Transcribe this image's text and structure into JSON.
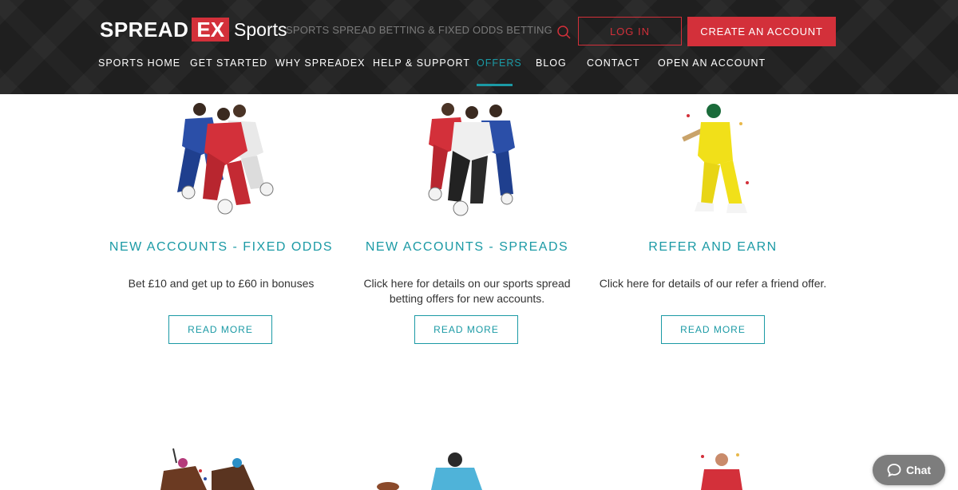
{
  "header": {
    "logo": {
      "spread": "SPREAD",
      "ex": "EX",
      "sports": "Sports"
    },
    "tagline": "SPORTS SPREAD BETTING & FIXED ODDS BETTING",
    "login_label": "LOG IN",
    "create_account_label": "CREATE AN ACCOUNT",
    "nav": [
      {
        "label": "SPORTS HOME"
      },
      {
        "label": "GET STARTED"
      },
      {
        "label": "WHY SPREADEX"
      },
      {
        "label": "HELP & SUPPORT"
      },
      {
        "label": "OFFERS",
        "active": true
      },
      {
        "label": "BLOG"
      },
      {
        "label": "CONTACT"
      },
      {
        "label": "OPEN AN ACCOUNT"
      }
    ]
  },
  "offers": [
    {
      "title": "NEW ACCOUNTS - FIXED ODDS",
      "description": "Bet £10 and get up to £60 in bonuses",
      "button": "READ MORE",
      "image_icon": "football-players-illustration"
    },
    {
      "title": "NEW ACCOUNTS - SPREADS",
      "description": "Click here for details on our sports spread betting offers for new accounts.",
      "button": "READ MORE",
      "image_icon": "football-players-illustration"
    },
    {
      "title": "REFER AND EARN",
      "description": "Click here for details of our refer a friend offer.",
      "button": "READ MORE",
      "image_icon": "cricket-batsman-illustration"
    }
  ],
  "chat": {
    "label": "Chat",
    "icon": "chat-bubble-icon"
  },
  "colors": {
    "accent": "#1b9aa5",
    "brand_red": "#d3303a",
    "header_bg": "#1f1f1f"
  }
}
